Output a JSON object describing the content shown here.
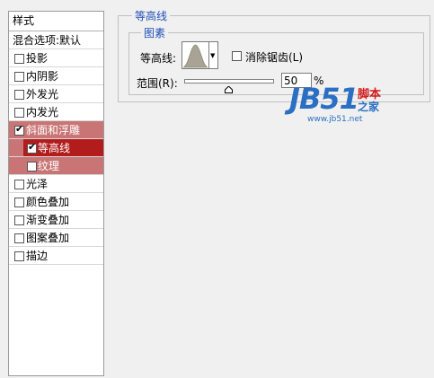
{
  "styles_panel": {
    "header": "样式",
    "blend_options": "混合选项:默认",
    "items": [
      {
        "label": "投影",
        "checked": false
      },
      {
        "label": "内阴影",
        "checked": false
      },
      {
        "label": "外发光",
        "checked": false
      },
      {
        "label": "内发光",
        "checked": false
      },
      {
        "label": "斜面和浮雕",
        "checked": true
      },
      {
        "label": "等高线",
        "checked": true
      },
      {
        "label": "纹理",
        "checked": false
      },
      {
        "label": "光泽",
        "checked": false
      },
      {
        "label": "颜色叠加",
        "checked": false
      },
      {
        "label": "渐变叠加",
        "checked": false
      },
      {
        "label": "图案叠加",
        "checked": false
      },
      {
        "label": "描边",
        "checked": false
      }
    ]
  },
  "contour_group": {
    "title": "等高线",
    "elements_title": "图素",
    "contour_label": "等高线:",
    "anti_alias_label": "消除锯齿(L)",
    "anti_alias_checked": false,
    "range_label": "范围(R):",
    "range_value": "50",
    "range_unit": "%"
  },
  "watermark": {
    "logo": "JB51",
    "red_text": "脚本",
    "blue_text": "之家",
    "url": "www.jb51.net"
  },
  "colors": {
    "selected_row": "#c97575",
    "active_row": "#b21c1c",
    "group_title": "#1f4fb4",
    "watermark_blue": "#2a6fc4",
    "watermark_red": "#d21c1c"
  }
}
